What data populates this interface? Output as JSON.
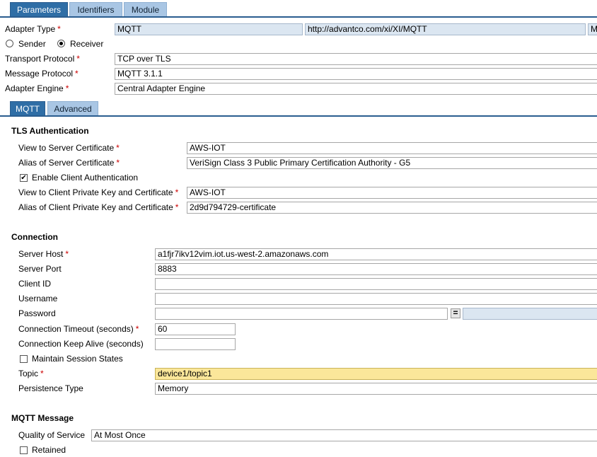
{
  "tabs": [
    "Parameters",
    "Identifiers",
    "Module"
  ],
  "adapter": {
    "type_label": "Adapter Type",
    "type_value": "MQTT",
    "namespace": "http://advantco.com/xi/XI/MQTT",
    "namespace_extra": "MC",
    "sender_label": "Sender",
    "receiver_label": "Receiver",
    "selected": "Receiver",
    "transport_label": "Transport Protocol",
    "transport_value": "TCP over TLS",
    "message_label": "Message Protocol",
    "message_value": "MQTT 3.1.1",
    "engine_label": "Adapter Engine",
    "engine_value": "Central Adapter Engine"
  },
  "subtabs": [
    "MQTT",
    "Advanced"
  ],
  "tls": {
    "title": "TLS Authentication",
    "view_server_label": "View to Server Certificate",
    "view_server_value": "AWS-IOT",
    "alias_server_label": "Alias of Server Certificate",
    "alias_server_value": "VeriSign Class 3 Public Primary Certification Authority - G5",
    "enable_client_label": "Enable Client Authentication",
    "enable_client_checked": true,
    "view_client_label": "View to Client Private Key and Certificate",
    "view_client_value": "AWS-IOT",
    "alias_client_label": "Alias of Client Private Key and Certificate",
    "alias_client_value": "2d9d794729-certificate"
  },
  "connection": {
    "title": "Connection",
    "host_label": "Server Host",
    "host_value": "a1fjr7ikv12vim.iot.us-west-2.amazonaws.com",
    "port_label": "Server Port",
    "port_value": "8883",
    "client_id_label": "Client ID",
    "client_id_value": "",
    "username_label": "Username",
    "username_value": "",
    "password_label": "Password",
    "password_value": "",
    "eq_symbol": "=",
    "timeout_label": "Connection Timeout (seconds)",
    "timeout_value": "60",
    "keepalive_label": "Connection Keep Alive (seconds)",
    "keepalive_value": "",
    "maintain_label": "Maintain Session States",
    "maintain_checked": false,
    "topic_label": "Topic",
    "topic_value": "device1/topic1",
    "persistence_label": "Persistence Type",
    "persistence_value": "Memory"
  },
  "mqtt_message": {
    "title": "MQTT Message",
    "qos_label": "Quality of Service",
    "qos_value": "At Most Once",
    "retained_label": "Retained",
    "retained_checked": false
  },
  "required_marker": "*",
  "check_mark": "✔"
}
